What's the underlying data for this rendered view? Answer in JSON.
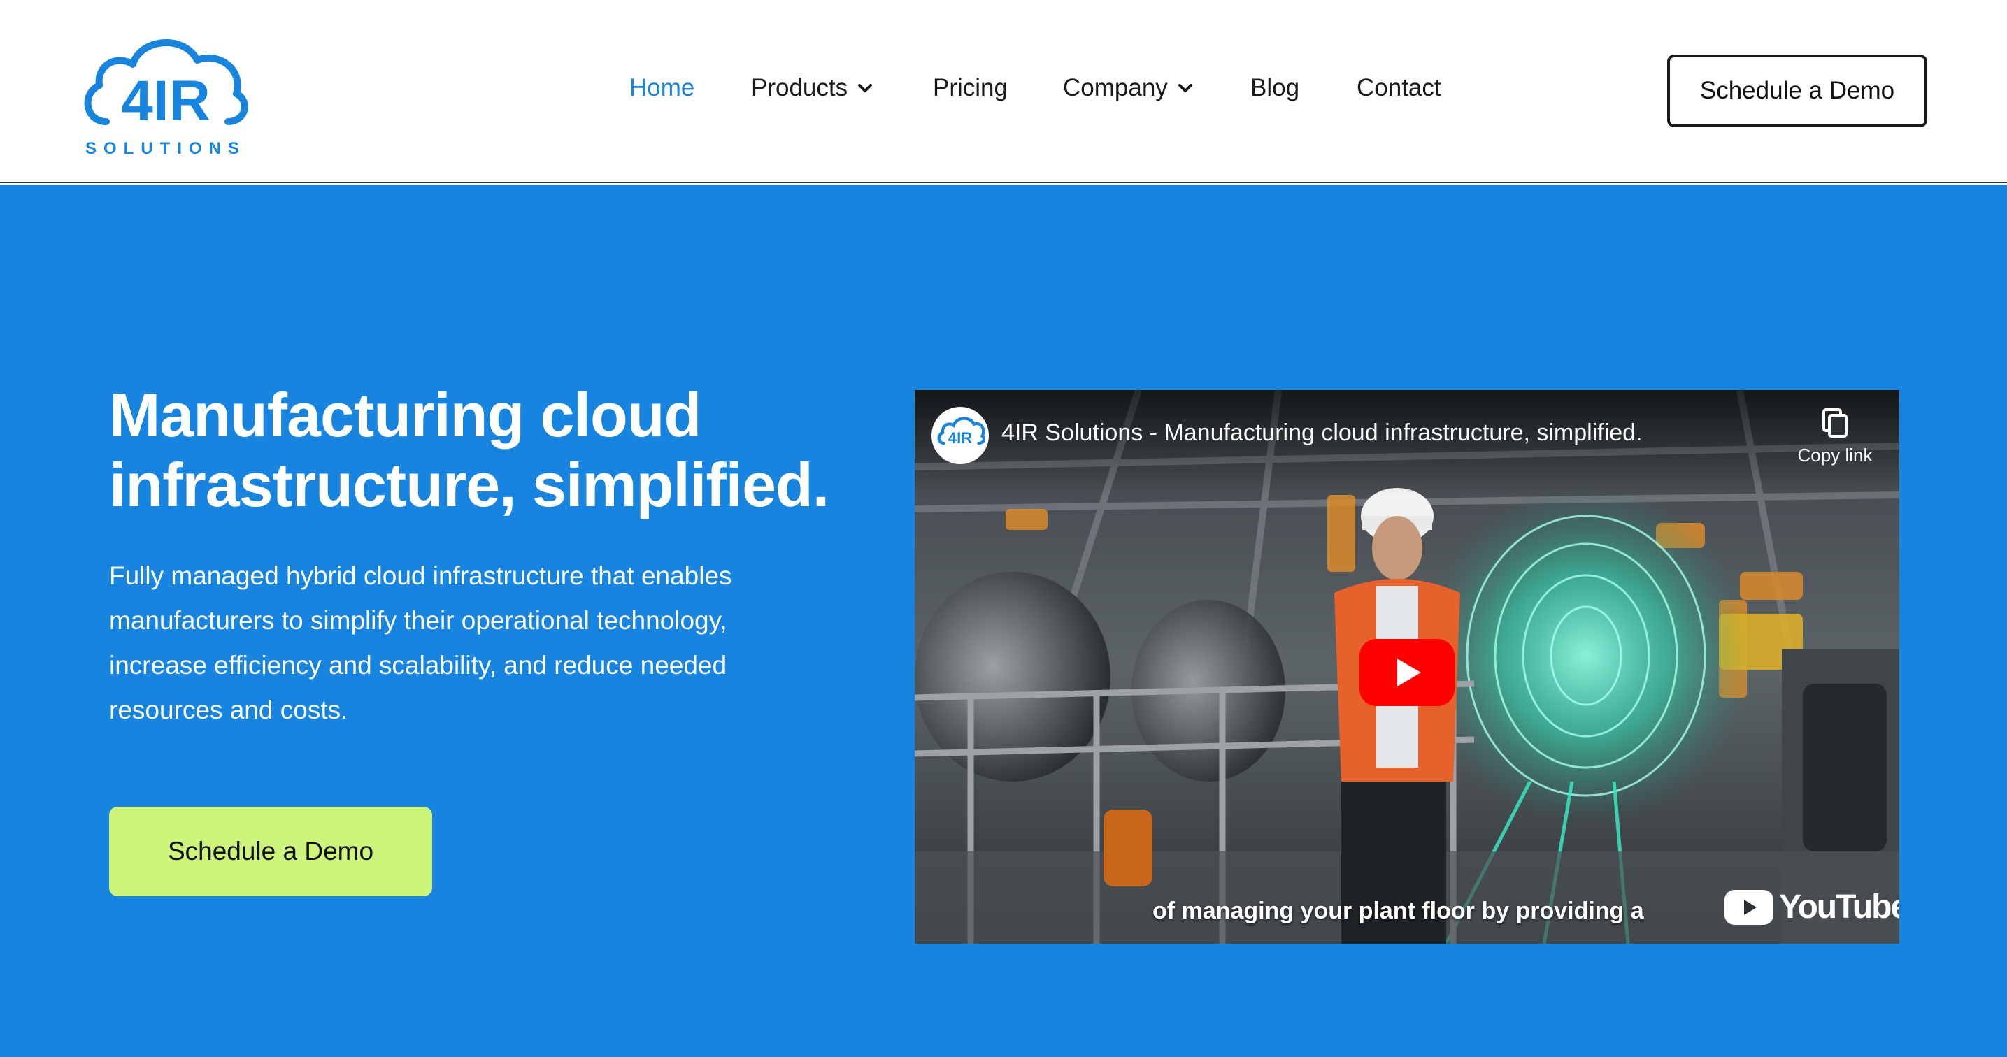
{
  "brand": {
    "logo_text": "4IR",
    "logo_subtext": "SOLUTIONS",
    "color": "#1785e0"
  },
  "nav": {
    "items": [
      {
        "label": "Home",
        "active": true,
        "dropdown": false
      },
      {
        "label": "Products",
        "active": false,
        "dropdown": true
      },
      {
        "label": "Pricing",
        "active": false,
        "dropdown": false
      },
      {
        "label": "Company",
        "active": false,
        "dropdown": true
      },
      {
        "label": "Blog",
        "active": false,
        "dropdown": false
      },
      {
        "label": "Contact",
        "active": false,
        "dropdown": false
      }
    ],
    "cta_label": "Schedule a Demo"
  },
  "hero": {
    "title_line1": "Manufacturing cloud",
    "title_line2": "infrastructure, simplified.",
    "desc_lines": [
      "Fully managed hybrid cloud infrastructure that enables",
      "manufacturers to simplify their operational technology,",
      "increase efficiency and scalability, and reduce needed",
      "resources and costs."
    ],
    "cta_label": "Schedule a Demo",
    "background": "#1785e0",
    "cta_color": "#cdf57c"
  },
  "video": {
    "title": "4IR Solutions - Manufacturing cloud infrastructure, simplified.",
    "copy_link_label": "Copy link",
    "caption": "of managing your plant floor by providing a",
    "platform_label": "YouTube",
    "play_color": "#ff0000"
  }
}
